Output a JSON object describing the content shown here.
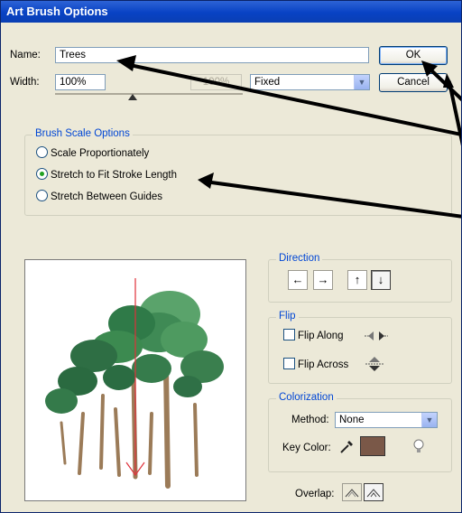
{
  "title": "Art Brush Options",
  "name": {
    "label": "Name:",
    "value": "Trees"
  },
  "width": {
    "label": "Width:",
    "value": "100%",
    "secondary": "100%",
    "mode": "Fixed"
  },
  "buttons": {
    "ok": "OK",
    "cancel": "Cancel"
  },
  "brush_scale": {
    "legend": "Brush Scale Options",
    "options": [
      "Scale Proportionately",
      "Stretch to Fit Stroke Length",
      "Stretch Between Guides"
    ],
    "selected_index": 1
  },
  "direction": {
    "legend": "Direction",
    "buttons": [
      "←",
      "→",
      "↑",
      "↓"
    ],
    "selected": "↓"
  },
  "flip": {
    "legend": "Flip",
    "along": "Flip Along",
    "across": "Flip Across"
  },
  "colorization": {
    "legend": "Colorization",
    "method_label": "Method:",
    "method_value": "None",
    "key_color_label": "Key Color:",
    "key_color_hex": "#7a5848"
  },
  "overlap": {
    "label": "Overlap:"
  },
  "colors": {
    "title_bar": "#0842c4",
    "legend_text": "#0046d5",
    "preview_arrow": "#e0303a"
  }
}
